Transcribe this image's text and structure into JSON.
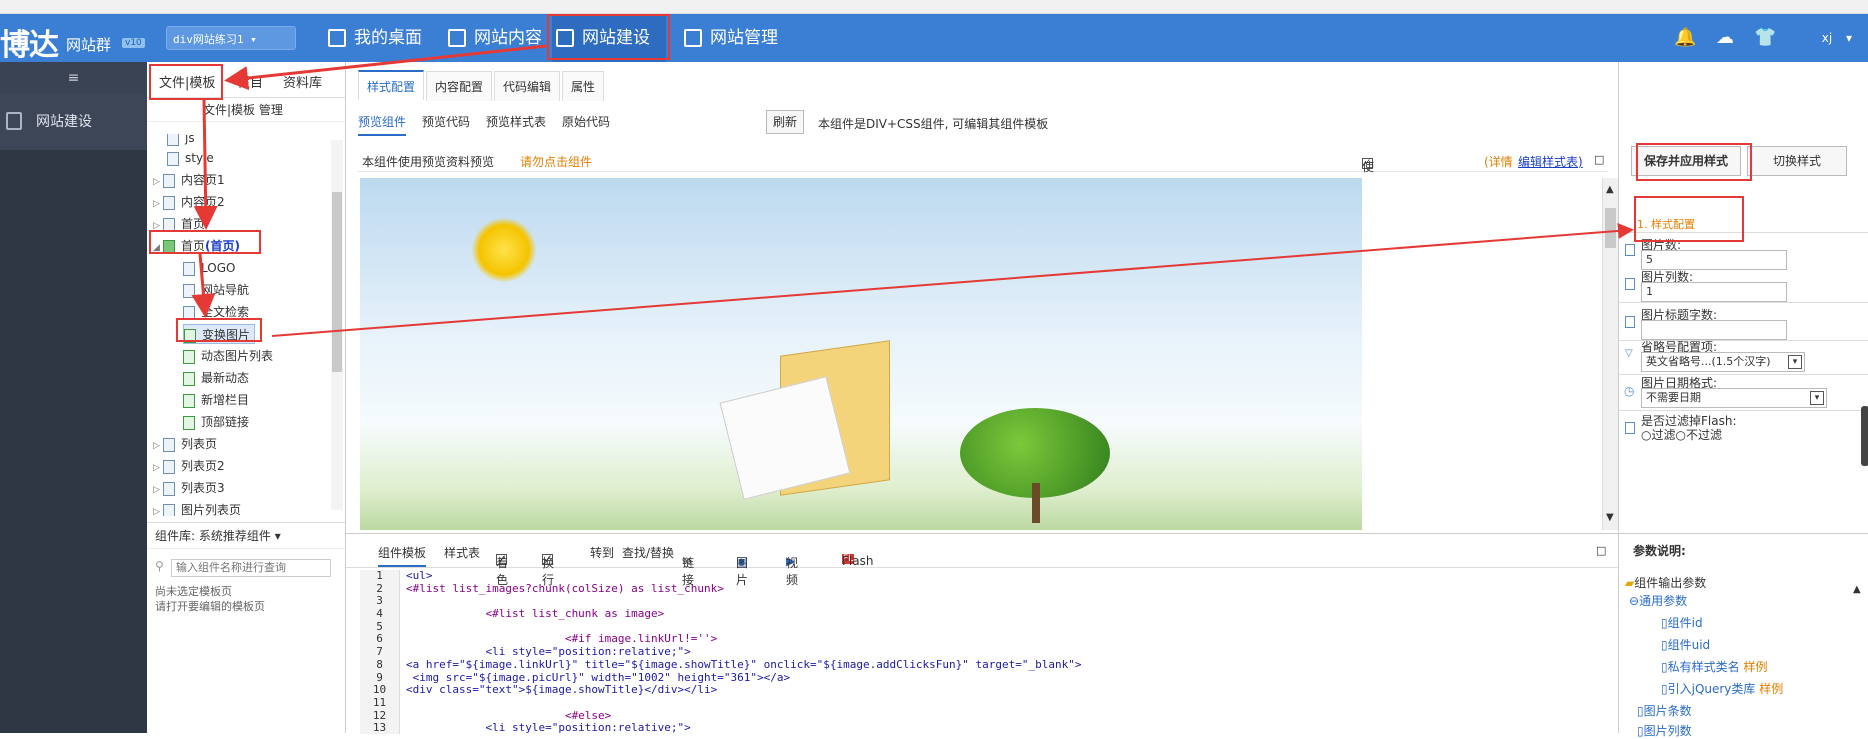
{
  "brand": {
    "name": "博达",
    "sub": "网站群",
    "version": "v10"
  },
  "site_select": "div网站练习1",
  "topnav": {
    "desktop": "我的桌面",
    "content": "网站内容",
    "build": "网站建设",
    "manage": "网站管理"
  },
  "user": "xj",
  "leftnav": {
    "collapse": "≡",
    "item": "网站建设"
  },
  "tree_tabs": {
    "file_template": "文件|模板",
    "column": "栏目",
    "library": "资料库"
  },
  "tree_sub": "文件|模板 管理",
  "tree": {
    "js": "js",
    "style": "style",
    "content1": "内容页1",
    "content2": "内容页2",
    "home": "首页",
    "home_main": "首页",
    "home_main_tag": "(首页)",
    "logo": "LOGO",
    "site_nav": "网站导航",
    "fulltext": "全文检索",
    "switch_img": "变换图片",
    "dyn_img_list": "动态图片列表",
    "latest": "最新动态",
    "new_col": "新增栏目",
    "top_link": "顶部链接",
    "list": "列表页",
    "list2": "列表页2",
    "list3": "列表页3",
    "img_list": "图片列表页"
  },
  "complib": {
    "header": "组件库: 系统推荐组件",
    "placeholder": "输入组件名称进行查询",
    "hint1": "尚未选定模板页",
    "hint2": "请打开要编辑的模板页"
  },
  "main_tabs": {
    "style": "样式配置",
    "content": "内容配置",
    "code": "代码编辑",
    "props": "属性"
  },
  "sub_tabs": {
    "preview_comp": "预览组件",
    "preview_code": "预览代码",
    "preview_style": "预览样式表",
    "source": "原始代码"
  },
  "refresh": "刷新",
  "comp_desc": "本组件是DIV+CSS组件, 可编辑其组件模板",
  "preview_bar": {
    "note": "本组件使用预览资料预览",
    "click": "请勿点击组件",
    "env": "使用模板环境预览",
    "detail": "(详情",
    "edit_style": "编辑样式表)"
  },
  "config": {
    "save_apply": "保存并应用样式",
    "switch": "切换样式",
    "section": "1. 样式配置",
    "img_count_label": "图片数:",
    "img_count": "5",
    "img_cols_label": "图片列数:",
    "img_cols": "1",
    "title_len_label": "图片标题字数:",
    "title_len": "",
    "ellipsis_label": "省略号配置项:",
    "ellipsis_value": "英文省略号...(1.5个汉字)",
    "date_label": "图片日期格式:",
    "date_value": "不需要日期",
    "flash_label": "是否过滤掉Flash:",
    "flash_opt1": "过滤",
    "flash_opt2": "不过滤"
  },
  "editor_toolbar": {
    "tpl": "组件模板",
    "css": "样式表",
    "color": "着色",
    "wrap": "换行",
    "goto": "转到",
    "find": "查找/替换",
    "link": "链接",
    "image": "图片",
    "video": "视频",
    "flash": "Flash"
  },
  "code_lines": [
    "<ul>",
    "<#list list_images?chunk(colSize) as list_chunk>",
    "",
    "            <#list list_chunk as image>",
    "",
    "                        <#if image.linkUrl!=''>",
    "            <li style=\"position:relative;\">",
    "<a href=\"${image.linkUrl}\" title=\"${image.showTitle}\" onclick=\"${image.addClicksFun}\" target=\"_blank\">",
    " <img src=\"${image.picUrl}\" width=\"1002\" height=\"361\"></a>",
    "<div class=\"text\">${image.showTitle}</div></li>",
    "",
    "                        <#else>",
    "            <li style=\"position:relative;\">"
  ],
  "params": {
    "header": "参数说明:",
    "root": "组件输出参数",
    "common": "通用参数",
    "comp_id": "组件id",
    "comp_uid": "组件uid",
    "private_style": "私有样式类名",
    "jquery": "引入jQuery类库",
    "example": "样例",
    "img_count": "图片条数",
    "img_cols": "图片列数"
  }
}
